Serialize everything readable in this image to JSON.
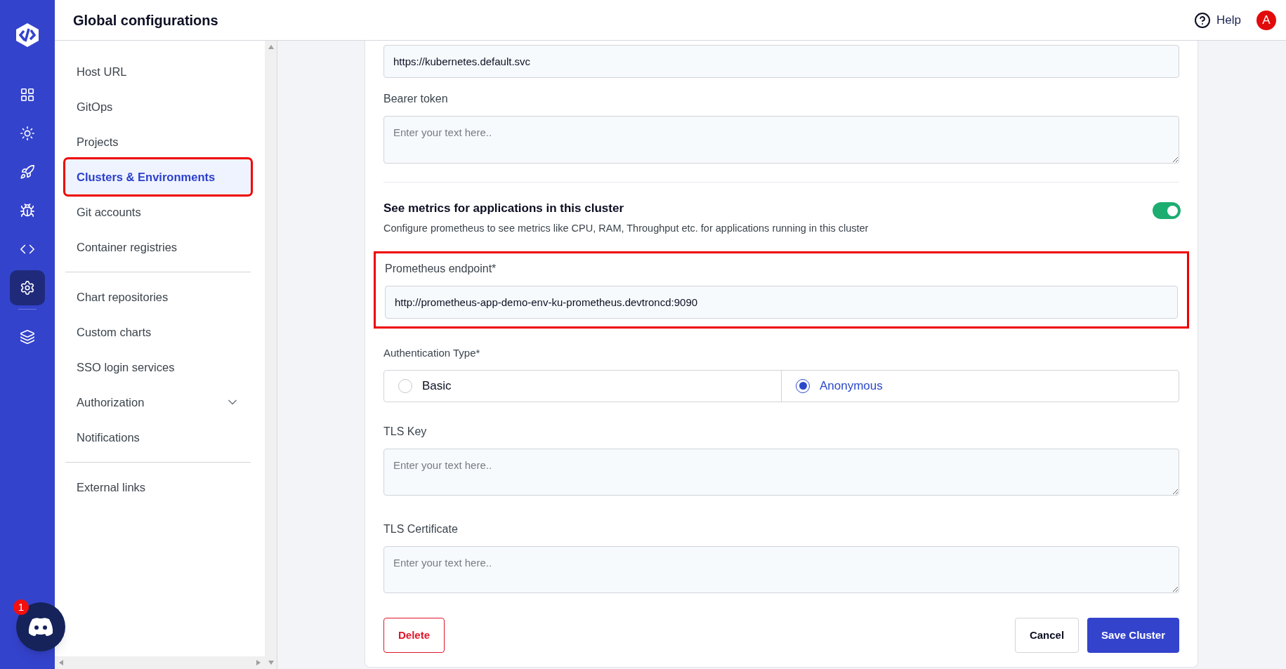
{
  "header": {
    "title": "Global configurations",
    "help": "Help",
    "avatar": "A"
  },
  "rail": {
    "items": [
      {
        "selected": false
      },
      {
        "selected": false
      },
      {
        "selected": false
      },
      {
        "selected": false
      },
      {
        "selected": false
      },
      {
        "selected": true
      },
      {
        "selected": false
      }
    ]
  },
  "sidebar": {
    "groups": [
      {
        "items": [
          {
            "label": "Host URL",
            "selected": false,
            "outlined": false
          },
          {
            "label": "GitOps",
            "selected": false,
            "outlined": false
          },
          {
            "label": "Projects",
            "selected": false,
            "outlined": false
          },
          {
            "label": "Clusters & Environments",
            "selected": true,
            "outlined": true
          },
          {
            "label": "Git accounts",
            "selected": false,
            "outlined": false
          },
          {
            "label": "Container registries",
            "selected": false,
            "outlined": false
          }
        ]
      },
      {
        "items": [
          {
            "label": "Chart repositories",
            "selected": false,
            "outlined": false
          },
          {
            "label": "Custom charts",
            "selected": false,
            "outlined": false
          },
          {
            "label": "SSO login services",
            "selected": false,
            "outlined": false
          },
          {
            "label": "Authorization",
            "selected": false,
            "outlined": false,
            "expanded": false
          },
          {
            "label": "Notifications",
            "selected": false,
            "outlined": false
          }
        ]
      },
      {
        "items": [
          {
            "label": "External links",
            "selected": false,
            "outlined": false
          }
        ]
      }
    ]
  },
  "form": {
    "server_url": {
      "value": "https://kubernetes.default.svc"
    },
    "bearer_token": {
      "label": "Bearer token",
      "placeholder": "Enter your text here.."
    },
    "metrics": {
      "title": "See metrics for applications in this cluster",
      "description": "Configure prometheus to see metrics like CPU, RAM, Throughput etc. for applications running in this cluster",
      "on": true
    },
    "prometheus": {
      "label": "Prometheus endpoint*",
      "value": "http://prometheus-app-demo-env-ku-prometheus.devtroncd:9090",
      "outlined": true
    },
    "auth_type": {
      "label": "Authentication Type*",
      "options": [
        {
          "label": "Basic",
          "selected": false
        },
        {
          "label": "Anonymous",
          "selected": true
        }
      ]
    },
    "tls_key": {
      "label": "TLS Key",
      "placeholder": "Enter your text here.."
    },
    "tls_certificate": {
      "label": "TLS Certificate",
      "placeholder": "Enter your text here.."
    },
    "buttons": {
      "delete": "Delete",
      "cancel": "Cancel",
      "save": "Save Cluster"
    }
  },
  "chat": {
    "badge": "1"
  }
}
